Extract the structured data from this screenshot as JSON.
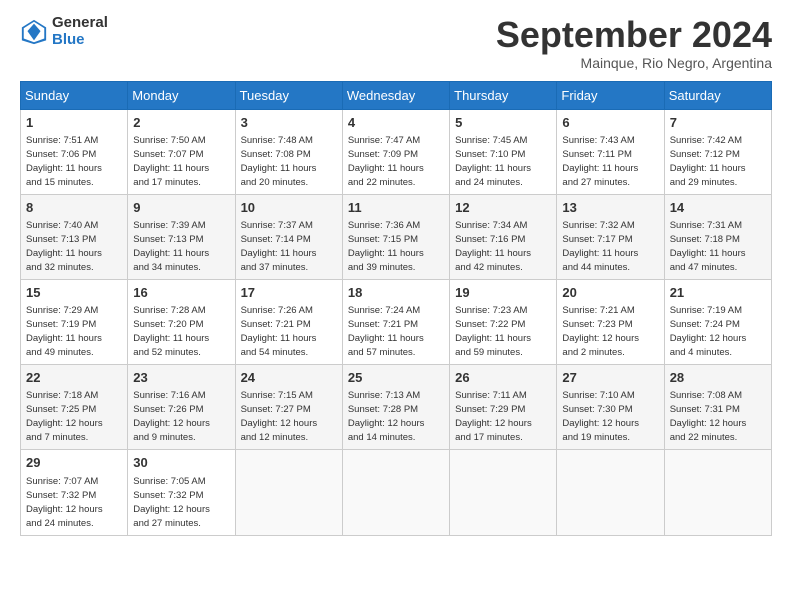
{
  "header": {
    "logo_line1": "General",
    "logo_line2": "Blue",
    "month_title": "September 2024",
    "location": "Mainque, Rio Negro, Argentina"
  },
  "weekdays": [
    "Sunday",
    "Monday",
    "Tuesday",
    "Wednesday",
    "Thursday",
    "Friday",
    "Saturday"
  ],
  "weeks": [
    [
      {
        "day": "1",
        "info": "Sunrise: 7:51 AM\nSunset: 7:06 PM\nDaylight: 11 hours\nand 15 minutes."
      },
      {
        "day": "2",
        "info": "Sunrise: 7:50 AM\nSunset: 7:07 PM\nDaylight: 11 hours\nand 17 minutes."
      },
      {
        "day": "3",
        "info": "Sunrise: 7:48 AM\nSunset: 7:08 PM\nDaylight: 11 hours\nand 20 minutes."
      },
      {
        "day": "4",
        "info": "Sunrise: 7:47 AM\nSunset: 7:09 PM\nDaylight: 11 hours\nand 22 minutes."
      },
      {
        "day": "5",
        "info": "Sunrise: 7:45 AM\nSunset: 7:10 PM\nDaylight: 11 hours\nand 24 minutes."
      },
      {
        "day": "6",
        "info": "Sunrise: 7:43 AM\nSunset: 7:11 PM\nDaylight: 11 hours\nand 27 minutes."
      },
      {
        "day": "7",
        "info": "Sunrise: 7:42 AM\nSunset: 7:12 PM\nDaylight: 11 hours\nand 29 minutes."
      }
    ],
    [
      {
        "day": "8",
        "info": "Sunrise: 7:40 AM\nSunset: 7:13 PM\nDaylight: 11 hours\nand 32 minutes."
      },
      {
        "day": "9",
        "info": "Sunrise: 7:39 AM\nSunset: 7:13 PM\nDaylight: 11 hours\nand 34 minutes."
      },
      {
        "day": "10",
        "info": "Sunrise: 7:37 AM\nSunset: 7:14 PM\nDaylight: 11 hours\nand 37 minutes."
      },
      {
        "day": "11",
        "info": "Sunrise: 7:36 AM\nSunset: 7:15 PM\nDaylight: 11 hours\nand 39 minutes."
      },
      {
        "day": "12",
        "info": "Sunrise: 7:34 AM\nSunset: 7:16 PM\nDaylight: 11 hours\nand 42 minutes."
      },
      {
        "day": "13",
        "info": "Sunrise: 7:32 AM\nSunset: 7:17 PM\nDaylight: 11 hours\nand 44 minutes."
      },
      {
        "day": "14",
        "info": "Sunrise: 7:31 AM\nSunset: 7:18 PM\nDaylight: 11 hours\nand 47 minutes."
      }
    ],
    [
      {
        "day": "15",
        "info": "Sunrise: 7:29 AM\nSunset: 7:19 PM\nDaylight: 11 hours\nand 49 minutes."
      },
      {
        "day": "16",
        "info": "Sunrise: 7:28 AM\nSunset: 7:20 PM\nDaylight: 11 hours\nand 52 minutes."
      },
      {
        "day": "17",
        "info": "Sunrise: 7:26 AM\nSunset: 7:21 PM\nDaylight: 11 hours\nand 54 minutes."
      },
      {
        "day": "18",
        "info": "Sunrise: 7:24 AM\nSunset: 7:21 PM\nDaylight: 11 hours\nand 57 minutes."
      },
      {
        "day": "19",
        "info": "Sunrise: 7:23 AM\nSunset: 7:22 PM\nDaylight: 11 hours\nand 59 minutes."
      },
      {
        "day": "20",
        "info": "Sunrise: 7:21 AM\nSunset: 7:23 PM\nDaylight: 12 hours\nand 2 minutes."
      },
      {
        "day": "21",
        "info": "Sunrise: 7:19 AM\nSunset: 7:24 PM\nDaylight: 12 hours\nand 4 minutes."
      }
    ],
    [
      {
        "day": "22",
        "info": "Sunrise: 7:18 AM\nSunset: 7:25 PM\nDaylight: 12 hours\nand 7 minutes."
      },
      {
        "day": "23",
        "info": "Sunrise: 7:16 AM\nSunset: 7:26 PM\nDaylight: 12 hours\nand 9 minutes."
      },
      {
        "day": "24",
        "info": "Sunrise: 7:15 AM\nSunset: 7:27 PM\nDaylight: 12 hours\nand 12 minutes."
      },
      {
        "day": "25",
        "info": "Sunrise: 7:13 AM\nSunset: 7:28 PM\nDaylight: 12 hours\nand 14 minutes."
      },
      {
        "day": "26",
        "info": "Sunrise: 7:11 AM\nSunset: 7:29 PM\nDaylight: 12 hours\nand 17 minutes."
      },
      {
        "day": "27",
        "info": "Sunrise: 7:10 AM\nSunset: 7:30 PM\nDaylight: 12 hours\nand 19 minutes."
      },
      {
        "day": "28",
        "info": "Sunrise: 7:08 AM\nSunset: 7:31 PM\nDaylight: 12 hours\nand 22 minutes."
      }
    ],
    [
      {
        "day": "29",
        "info": "Sunrise: 7:07 AM\nSunset: 7:32 PM\nDaylight: 12 hours\nand 24 minutes."
      },
      {
        "day": "30",
        "info": "Sunrise: 7:05 AM\nSunset: 7:32 PM\nDaylight: 12 hours\nand 27 minutes."
      },
      null,
      null,
      null,
      null,
      null
    ]
  ]
}
